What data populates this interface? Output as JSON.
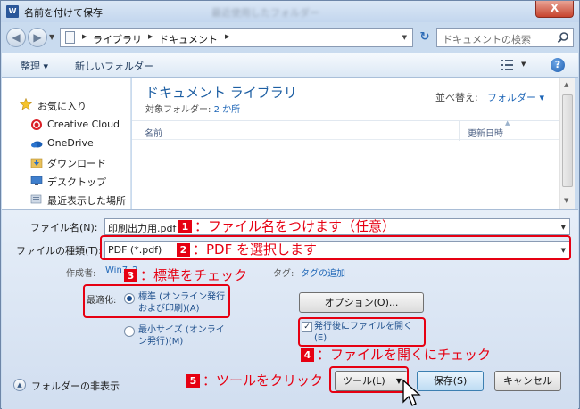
{
  "window": {
    "title": "名前を付けて保存",
    "blurred_title": "最近使用したフォルダー",
    "close_label": "X"
  },
  "nav": {
    "breadcrumb": [
      "ライブラリ",
      "ドキュメント"
    ],
    "search_placeholder": "ドキュメントの検索"
  },
  "toolbar": {
    "organize_label": "整理 ▾",
    "new_folder_label": "新しいフォルダー",
    "help_label": "?"
  },
  "sidebar": {
    "items": [
      {
        "label": "お気に入り",
        "icon": "star-icon"
      },
      {
        "label": "Creative Cloud",
        "icon": "creative-cloud-icon"
      },
      {
        "label": "OneDrive",
        "icon": "onedrive-icon"
      },
      {
        "label": "ダウンロード",
        "icon": "download-folder-icon"
      },
      {
        "label": "デスクトップ",
        "icon": "desktop-icon"
      },
      {
        "label": "最近表示した場所",
        "icon": "recent-places-icon"
      }
    ]
  },
  "library": {
    "title": "ドキュメント ライブラリ",
    "subtitle_label": "対象フォルダー:",
    "subtitle_value": "2 か所",
    "sort_label": "並べ替え:",
    "sort_value": "フォルダー ▾",
    "columns": [
      "名前",
      "更新日時"
    ]
  },
  "form": {
    "filename_label": "ファイル名(N):",
    "filename_value": "印刷出力用.pdf",
    "filetype_label": "ファイルの種類(T):",
    "filetype_value": "PDF (*.pdf)",
    "author_label": "作成者:",
    "author_value": "Win7_2",
    "tags_label": "タグ:",
    "tags_value": "タグの追加",
    "optimize_label": "最適化:",
    "optimize_standard": "標準 (オンライン発行\nおよび印刷)(A)",
    "optimize_min": "最小サイズ (オンライ\nン発行)(M)",
    "options_button": "オプション(O)...",
    "open_after_label": "発行後にファイルを開く\n(E)",
    "open_after_checked": "✓",
    "hide_folders": "フォルダーの非表示",
    "tools_button": "ツール(L)",
    "save_button": "保存(S)",
    "cancel_button": "キャンセル"
  },
  "annotations": {
    "a1_num": "1",
    "a1_text": "：ファイル名をつけます（任意）",
    "a2_num": "2",
    "a2_text": "：PDF を選択します",
    "a3_num": "3",
    "a3_text": "：標準をチェック",
    "a4_num": "4",
    "a4_text": "：ファイルを開くにチェック",
    "a5_num": "5",
    "a5_text": "：ツールをクリック",
    "color": "#e60012"
  }
}
